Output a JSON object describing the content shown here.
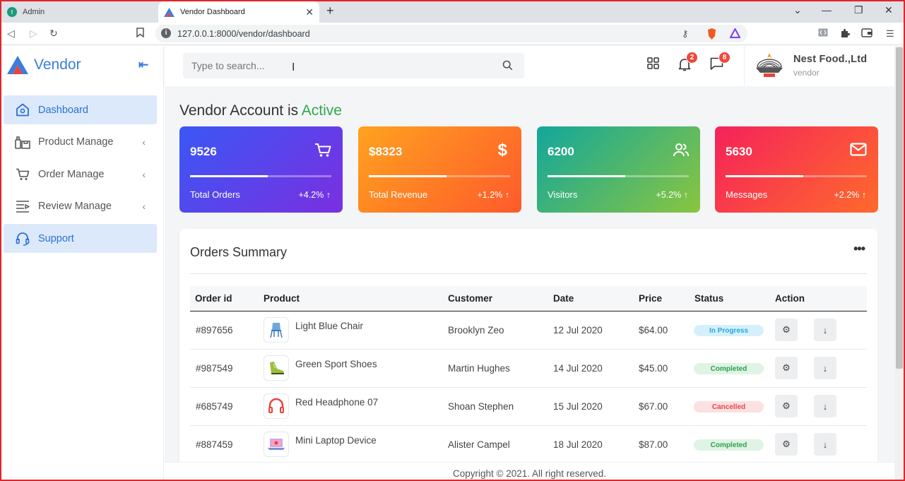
{
  "browser": {
    "tabs": [
      {
        "title": "Admin",
        "favicon": "t"
      },
      {
        "title": "Vendor Dashboard"
      }
    ],
    "url": "127.0.0.1:8000/vendor/dashboard"
  },
  "sidebar": {
    "brand": "Vendor",
    "items": [
      {
        "label": "Dashboard",
        "icon": "home-icon",
        "active": true
      },
      {
        "label": "Product Manage",
        "icon": "product-icon",
        "submenu": true
      },
      {
        "label": "Order Manage",
        "icon": "cart-icon",
        "submenu": true
      },
      {
        "label": "Review Manage",
        "icon": "list-icon",
        "submenu": true
      },
      {
        "label": "Support",
        "icon": "headset-icon",
        "active": true
      }
    ]
  },
  "topbar": {
    "search_placeholder": "Type to search...",
    "notifications_count": "2",
    "messages_count": "8",
    "user": {
      "name": "Nest Food.,Ltd",
      "role": "vendor"
    }
  },
  "main": {
    "headline_prefix": "Vendor Account is ",
    "headline_status": "Active",
    "stats": [
      {
        "value": "9526",
        "label": "Total Orders",
        "change": "+4.2% ↑",
        "progress": 0.55,
        "icon": "cart-icon",
        "gradient": [
          "#3a57f5",
          "#7b2fe0"
        ]
      },
      {
        "value": "$8323",
        "label": "Total Revenue",
        "change": "+1.2% ↑",
        "progress": 0.55,
        "icon": "dollar-icon",
        "gradient": [
          "#ffa21f",
          "#ff5a2b"
        ]
      },
      {
        "value": "6200",
        "label": "Visitors",
        "change": "+5.2% ↑",
        "progress": 0.55,
        "icon": "users-icon",
        "gradient": [
          "#12a79c",
          "#8ac53f"
        ]
      },
      {
        "value": "5630",
        "label": "Messages",
        "change": "+2.2% ↑",
        "progress": 0.55,
        "icon": "mail-icon",
        "gradient": [
          "#f5225a",
          "#ff6a2b"
        ]
      }
    ],
    "orders": {
      "title": "Orders Summary",
      "headers": [
        "Order id",
        "Product",
        "Customer",
        "Date",
        "Price",
        "Status",
        "Action"
      ],
      "rows": [
        {
          "id": "#897656",
          "product": "Light Blue Chair",
          "customer": "Brooklyn Zeo",
          "date": "12 Jul 2020",
          "price": "$64.00",
          "status": "In Progress",
          "status_class": "st-progress",
          "thumb": "chair"
        },
        {
          "id": "#987549",
          "product": "Green Sport Shoes",
          "customer": "Martin Hughes",
          "date": "14 Jul 2020",
          "price": "$45.00",
          "status": "Completed",
          "status_class": "st-completed",
          "thumb": "shoe"
        },
        {
          "id": "#685749",
          "product": "Red Headphone 07",
          "customer": "Shoan Stephen",
          "date": "15 Jul 2020",
          "price": "$67.00",
          "status": "Cancelled",
          "status_class": "st-cancelled",
          "thumb": "headphone"
        },
        {
          "id": "#887459",
          "product": "Mini Laptop Device",
          "customer": "Alister Campel",
          "date": "18 Jul 2020",
          "price": "$87.00",
          "status": "Completed",
          "status_class": "st-completed",
          "thumb": "laptop"
        }
      ]
    }
  },
  "footer": {
    "text": "Copyright © 2021. All right reserved."
  }
}
